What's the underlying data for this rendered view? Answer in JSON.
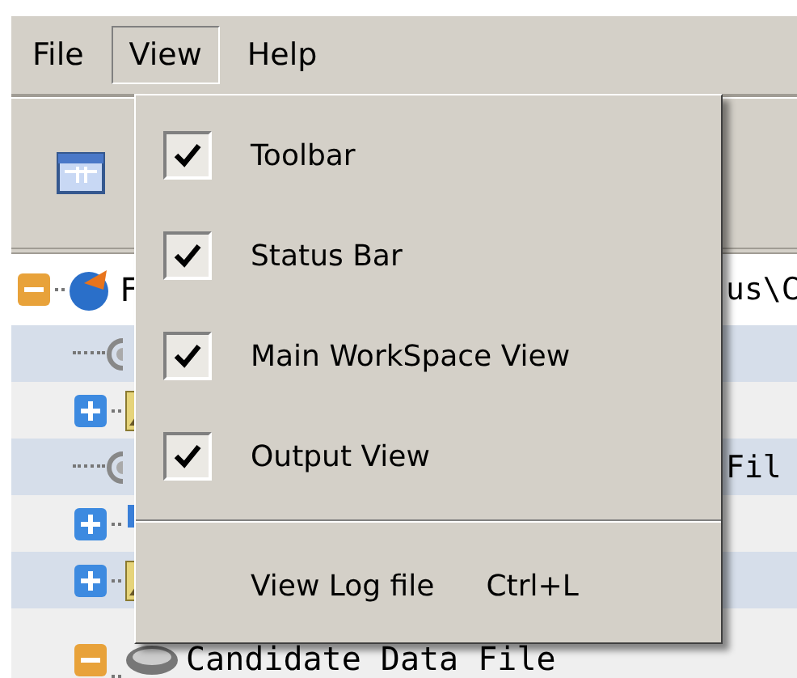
{
  "menu_bar": [
    {
      "label": "File",
      "selected": false
    },
    {
      "label": "View",
      "selected": true
    },
    {
      "label": "Help",
      "selected": false
    }
  ],
  "toolbar": {
    "buttons": [
      {
        "kind": "window"
      }
    ]
  },
  "tree": [
    {
      "label": "F",
      "label_tail": "us\\C",
      "kind": "globe",
      "expanded": true,
      "children": [
        {
          "kind": "gear"
        },
        {
          "kind": "picture",
          "expanded": false
        },
        {
          "label_tail": "Fil",
          "kind": "gear"
        },
        {
          "kind": "blocks",
          "expanded": false
        },
        {
          "kind": "picture",
          "expanded": false
        },
        {
          "label": "Candidate Data File",
          "kind": "disk",
          "expanded": true
        }
      ]
    }
  ],
  "view_menu": {
    "items": [
      {
        "kind": "check",
        "label": "Toolbar",
        "checked": true
      },
      {
        "kind": "check",
        "label": "Status Bar",
        "checked": true
      },
      {
        "kind": "check",
        "label": "Main WorkSpace View",
        "checked": true
      },
      {
        "kind": "check",
        "label": "Output View",
        "checked": true
      },
      {
        "kind": "separator"
      },
      {
        "kind": "command",
        "label": "View Log file",
        "shortcut": "Ctrl+L"
      }
    ]
  }
}
